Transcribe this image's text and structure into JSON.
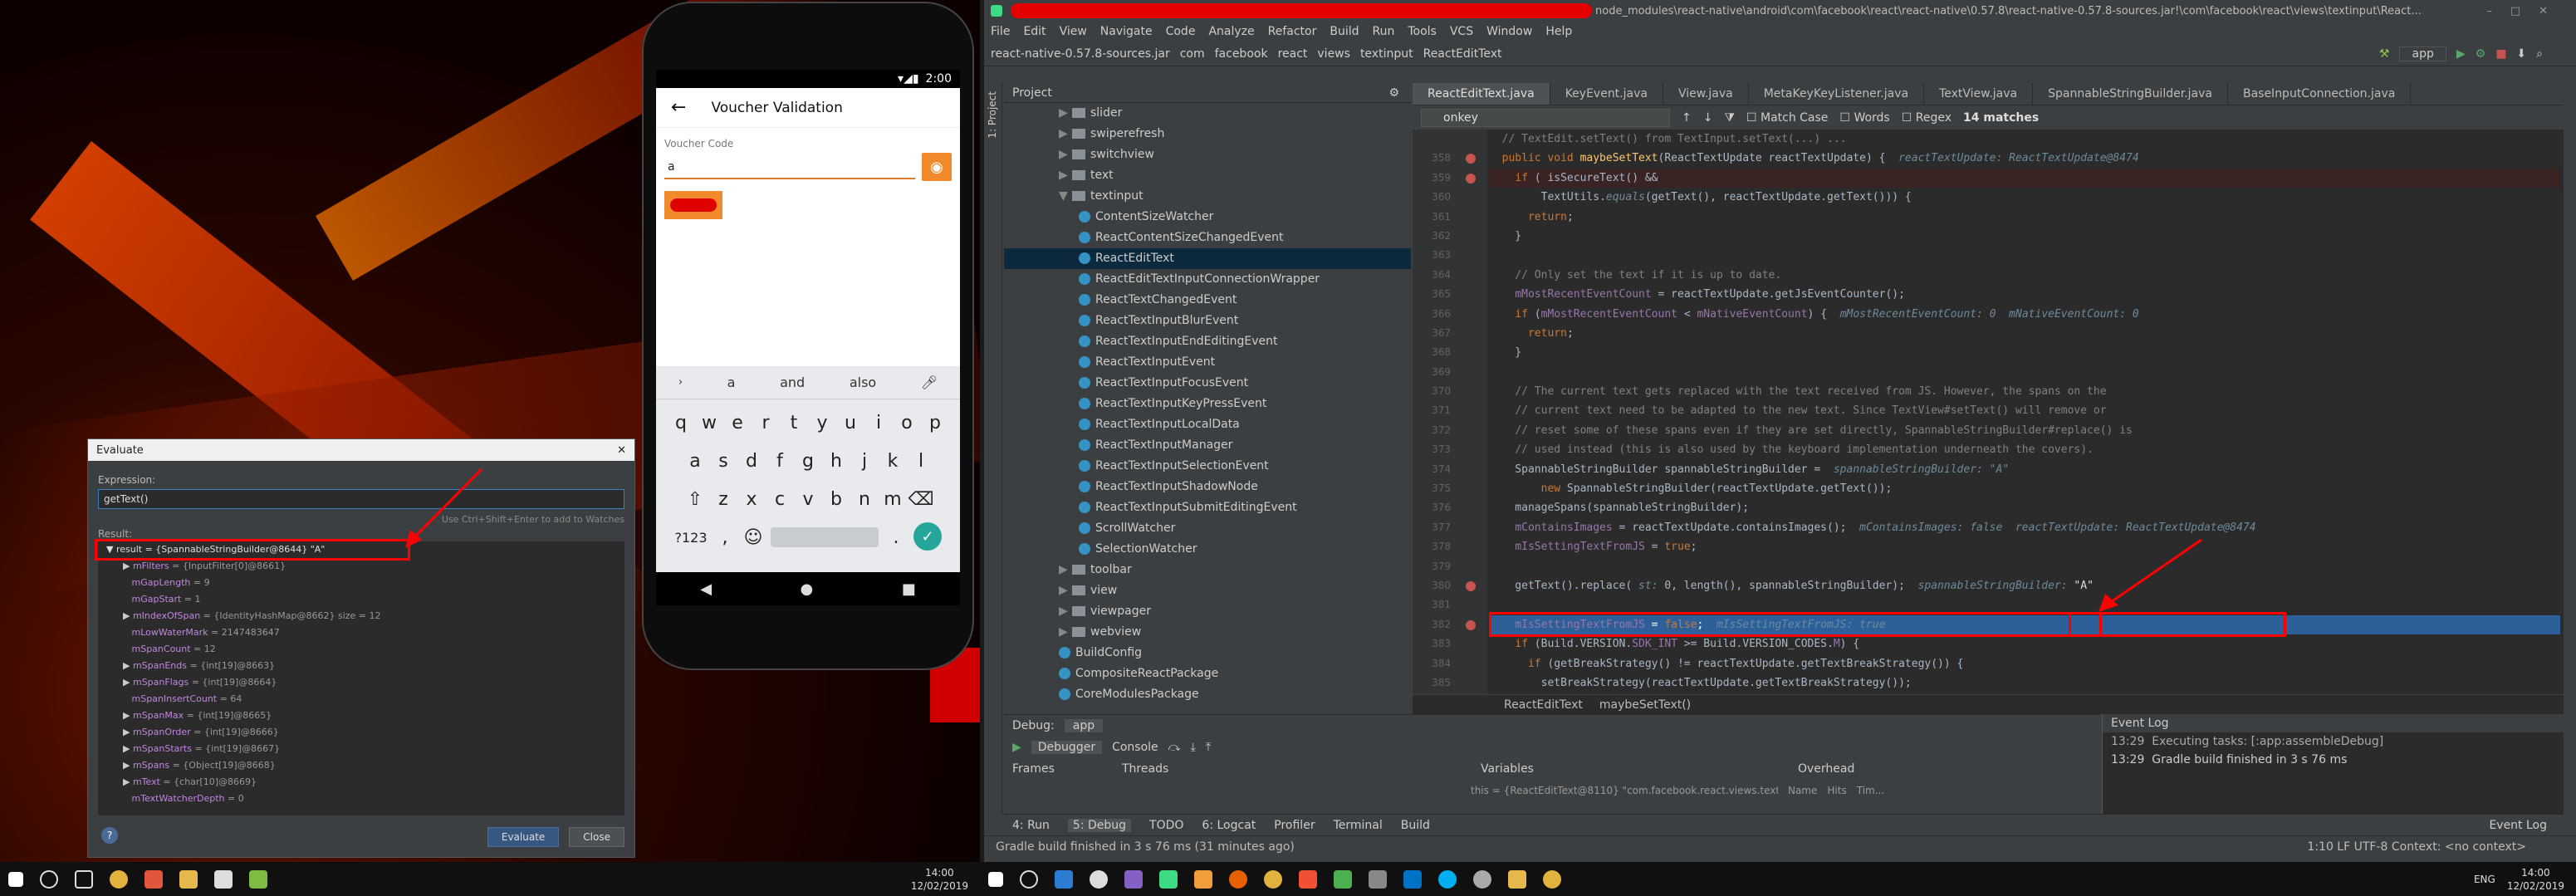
{
  "colors": {
    "ide_bg": "#2b2b2b",
    "accent_orange": "#f08a2c",
    "highlight_red": "#ff0000",
    "exec_line": "#2d6099"
  },
  "phone": {
    "status_time": "2:00",
    "title": "Voucher Validation",
    "voucher_label": "Voucher Code",
    "voucher_value": "a",
    "suggestions": [
      "a",
      "and",
      "also"
    ],
    "keyboard_rows": [
      [
        "q",
        "w",
        "e",
        "r",
        "t",
        "y",
        "u",
        "i",
        "o",
        "p"
      ],
      [
        "a",
        "s",
        "d",
        "f",
        "g",
        "h",
        "j",
        "k",
        "l"
      ],
      [
        "z",
        "x",
        "c",
        "v",
        "b",
        "n",
        "m"
      ]
    ],
    "symbols_key": "?123",
    "period_key": ".",
    "comma_key": ","
  },
  "evaluate": {
    "title": "Evaluate",
    "expression_label": "Expression:",
    "expression": "getText()",
    "hint": "Use Ctrl+Shift+Enter to add to Watches",
    "result_label": "Result:",
    "root": "result = {SpannableStringBuilder@8644} \"A\"",
    "rows": [
      {
        "n": "mFilters",
        "v": " = {InputFilter[0]@8661}"
      },
      {
        "n": "mGapLength",
        "v": " = 9"
      },
      {
        "n": "mGapStart",
        "v": " = 1"
      },
      {
        "n": "mIndexOfSpan",
        "v": " = {IdentityHashMap@8662}  size = 12"
      },
      {
        "n": "mLowWaterMark",
        "v": " = 2147483647"
      },
      {
        "n": "mSpanCount",
        "v": " = 12"
      },
      {
        "n": "mSpanEnds",
        "v": " = {int[19]@8663}"
      },
      {
        "n": "mSpanFlags",
        "v": " = {int[19]@8664}"
      },
      {
        "n": "mSpanInsertCount",
        "v": " = 64"
      },
      {
        "n": "mSpanMax",
        "v": " = {int[19]@8665}"
      },
      {
        "n": "mSpanOrder",
        "v": " = {int[19]@8666}"
      },
      {
        "n": "mSpanStarts",
        "v": " = {int[19]@8667}"
      },
      {
        "n": "mSpans",
        "v": " = {Object[19]@8668}"
      },
      {
        "n": "mText",
        "v": " = {char[10]@8669}"
      },
      {
        "n": "mTextWatcherDepth",
        "v": " = 0"
      }
    ],
    "evaluate_btn": "Evaluate",
    "close_btn": "Close"
  },
  "ide": {
    "title_suffix": "node_modules\\react-native\\android\\com\\facebook\\react\\react-native\\0.57.8\\react-native-0.57.8-sources.jar!\\com\\facebook\\react\\views\\textinput\\React...",
    "menu": [
      "File",
      "Edit",
      "View",
      "Navigate",
      "Code",
      "Analyze",
      "Refactor",
      "Build",
      "Run",
      "Tools",
      "VCS",
      "Window",
      "Help"
    ],
    "breadcrumbs": [
      "react-native-0.57.8-sources.jar",
      "com",
      "facebook",
      "react",
      "views",
      "textinput",
      "ReactEditText"
    ],
    "run_config": "app",
    "project_label": "Project",
    "tree": [
      {
        "label": "slider",
        "kind": "folder",
        "indent": 1,
        "arrow": "▶"
      },
      {
        "label": "swiperefresh",
        "kind": "folder",
        "indent": 1,
        "arrow": "▶"
      },
      {
        "label": "switchview",
        "kind": "folder",
        "indent": 1,
        "arrow": "▶"
      },
      {
        "label": "text",
        "kind": "folder",
        "indent": 1,
        "arrow": "▶"
      },
      {
        "label": "textinput",
        "kind": "folder",
        "indent": 1,
        "arrow": "▼"
      },
      {
        "label": "ContentSizeWatcher",
        "kind": "class",
        "indent": 2
      },
      {
        "label": "ReactContentSizeChangedEvent",
        "kind": "class",
        "indent": 2
      },
      {
        "label": "ReactEditText",
        "kind": "class",
        "indent": 2,
        "selected": true
      },
      {
        "label": "ReactEditTextInputConnectionWrapper",
        "kind": "class",
        "indent": 2
      },
      {
        "label": "ReactTextChangedEvent",
        "kind": "class",
        "indent": 2
      },
      {
        "label": "ReactTextInputBlurEvent",
        "kind": "class",
        "indent": 2
      },
      {
        "label": "ReactTextInputEndEditingEvent",
        "kind": "class",
        "indent": 2
      },
      {
        "label": "ReactTextInputEvent",
        "kind": "class",
        "indent": 2
      },
      {
        "label": "ReactTextInputFocusEvent",
        "kind": "class",
        "indent": 2
      },
      {
        "label": "ReactTextInputKeyPressEvent",
        "kind": "class",
        "indent": 2
      },
      {
        "label": "ReactTextInputLocalData",
        "kind": "class",
        "indent": 2
      },
      {
        "label": "ReactTextInputManager",
        "kind": "class",
        "indent": 2
      },
      {
        "label": "ReactTextInputSelectionEvent",
        "kind": "class",
        "indent": 2
      },
      {
        "label": "ReactTextInputShadowNode",
        "kind": "class",
        "indent": 2
      },
      {
        "label": "ReactTextInputSubmitEditingEvent",
        "kind": "class",
        "indent": 2
      },
      {
        "label": "ScrollWatcher",
        "kind": "class",
        "indent": 2
      },
      {
        "label": "SelectionWatcher",
        "kind": "class",
        "indent": 2
      },
      {
        "label": "toolbar",
        "kind": "folder",
        "indent": 1,
        "arrow": "▶"
      },
      {
        "label": "view",
        "kind": "folder",
        "indent": 1,
        "arrow": "▶"
      },
      {
        "label": "viewpager",
        "kind": "folder",
        "indent": 1,
        "arrow": "▶"
      },
      {
        "label": "webview",
        "kind": "folder",
        "indent": 1,
        "arrow": "▶"
      },
      {
        "label": "BuildConfig",
        "kind": "class",
        "indent": 0
      },
      {
        "label": "CompositeReactPackage",
        "kind": "class",
        "indent": 0
      },
      {
        "label": "CoreModulesPackage",
        "kind": "class",
        "indent": 0
      }
    ],
    "tabs": [
      "ReactEditText.java",
      "KeyEvent.java",
      "View.java",
      "MetaKeyKeyListener.java",
      "TextView.java",
      "SpannableStringBuilder.java",
      "BaseInputConnection.java"
    ],
    "find_query": "onkey",
    "find_match_case": "Match Case",
    "find_words": "Words",
    "find_regex": "Regex",
    "find_matches": "14 matches",
    "code_lines": [
      {
        "no": "",
        "html": "<span class='cm'>  // TextEdit.setText() from TextInput.setText(...) ...</span>"
      },
      {
        "no": "358",
        "bp": true,
        "html": "  <span class='kw'>public void</span> <span class='fn'>maybeSetText</span>(ReactTextUpdate reactTextUpdate) {  <span class='inl'>reactTextUpdate: ReactTextUpdate@8474</span>"
      },
      {
        "no": "359",
        "bp": true,
        "hl": true,
        "html": "    <span class='kw'>if</span> ( isSecureText() &amp;&amp;"
      },
      {
        "no": "360",
        "html": "        TextUtils.<span class='inl'>equals</span>(getText(), reactTextUpdate.getText())) {"
      },
      {
        "no": "361",
        "html": "      <span class='kw'>return</span>;"
      },
      {
        "no": "362",
        "html": "    }"
      },
      {
        "no": "363",
        "html": ""
      },
      {
        "no": "364",
        "html": "    <span class='cm'>// Only set the text if it is up to date.</span>"
      },
      {
        "no": "365",
        "html": "    <span class='fld'>mMostRecentEventCount</span> = reactTextUpdate.getJsEventCounter();"
      },
      {
        "no": "366",
        "html": "    <span class='kw'>if</span> (<span class='fld'>mMostRecentEventCount</span> &lt; <span class='fld'>mNativeEventCount</span>) {  <span class='inl'>mMostRecentEventCount: 0  mNativeEventCount: 0</span>"
      },
      {
        "no": "367",
        "html": "      <span class='kw'>return</span>;"
      },
      {
        "no": "368",
        "html": "    }"
      },
      {
        "no": "369",
        "html": ""
      },
      {
        "no": "370",
        "html": "    <span class='cm'>// The current text gets replaced with the text received from JS. However, the spans on the</span>"
      },
      {
        "no": "371",
        "html": "    <span class='cm'>// current text need to be adapted to the new text. Since TextView#setText() will remove or</span>"
      },
      {
        "no": "372",
        "html": "    <span class='cm'>// reset some of these spans even if they are set directly, SpannableStringBuilder#replace() is</span>"
      },
      {
        "no": "373",
        "html": "    <span class='cm'>// used instead (this is also used by the keyboard implementation underneath the covers).</span>"
      },
      {
        "no": "374",
        "html": "    SpannableStringBuilder spannableStringBuilder =  <span class='inl'>spannableStringBuilder: \"A\"</span>"
      },
      {
        "no": "375",
        "html": "        <span class='kw'>new</span> SpannableStringBuilder(reactTextUpdate.getText());"
      },
      {
        "no": "376",
        "html": "    manageSpans(spannableStringBuilder);"
      },
      {
        "no": "377",
        "html": "    <span class='fld'>mContainsImages</span> = reactTextUpdate.containsImages();  <span class='inl'>mContainsImages: false  reactTextUpdate: ReactTextUpdate@8474</span>"
      },
      {
        "no": "378",
        "html": "    <span class='fld'>mIsSettingTextFromJS</span> = <span class='kw'>true</span>;"
      },
      {
        "no": "379",
        "html": ""
      },
      {
        "no": "380",
        "bp": true,
        "html": "    getText().replace( <span class='inl'>st:</span> 0, length(), spannableStringBuilder);  <span class='inl'>spannableStringBuilder: </span><span style='color:#ddd'>\"A\"</span>"
      },
      {
        "no": "381",
        "html": ""
      },
      {
        "no": "382",
        "bp": true,
        "exec": true,
        "html": "    <span class='fld'>mIsSettingTextFromJS</span> = <span class='kw'>false</span>;  <span class='inl'>mIsSettingTextFromJS: true</span>"
      },
      {
        "no": "383",
        "html": "    <span class='kw'>if</span> (Build.VERSION.<span class='fld'>SDK_INT</span> &gt;= Build.VERSION_CODES.<span class='fld'>M</span>) {"
      },
      {
        "no": "384",
        "html": "      <span class='kw'>if</span> (getBreakStrategy() != reactTextUpdate.getTextBreakStrategy()) {"
      },
      {
        "no": "385",
        "html": "        setBreakStrategy(reactTextUpdate.getTextBreakStrategy());"
      },
      {
        "no": "386",
        "html": "      }"
      },
      {
        "no": "387",
        "html": "    }"
      },
      {
        "no": "388",
        "html": "  }"
      }
    ],
    "code_breadcrumb": [
      "ReactEditText",
      "maybeSetText()"
    ],
    "debug_label": "Debug:",
    "debug_config": "app",
    "debugger_tab": "Debugger",
    "console_tab": "Console",
    "frames_label": "Frames",
    "threads_label": "Threads",
    "variables_label": "Variables",
    "overhead_label": "Overhead",
    "var_row": "this = {ReactEditText@8110} \"com.facebook.react.views.textinput.ReactEditText{c53c7 VFED.CL...",
    "name_col": "Name",
    "hits_col": "Hits",
    "time_col": "Tim...",
    "event_log_title": "Event Log",
    "event_log": [
      {
        "time": "13:29",
        "msg": "Executing tasks: [:app:assembleDebug]"
      },
      {
        "time": "13:29",
        "msg": "Gradle build finished in 3 s 76 ms"
      }
    ],
    "tool_tabs": [
      "4: Run",
      "5: Debug",
      "TODO",
      "6: Logcat",
      "Profiler",
      "Terminal",
      "Build"
    ],
    "event_log_tab": "Event Log",
    "status": "Gradle build finished in 3 s 76 ms (31 minutes ago)",
    "status_right": "1:10   LF   UTF-8   Context: <no context>"
  },
  "taskbar": {
    "left_time": "14:00",
    "left_date": "12/02/2019",
    "right_time": "14:00",
    "right_date": "12/02/2019",
    "lang": "ENG"
  }
}
